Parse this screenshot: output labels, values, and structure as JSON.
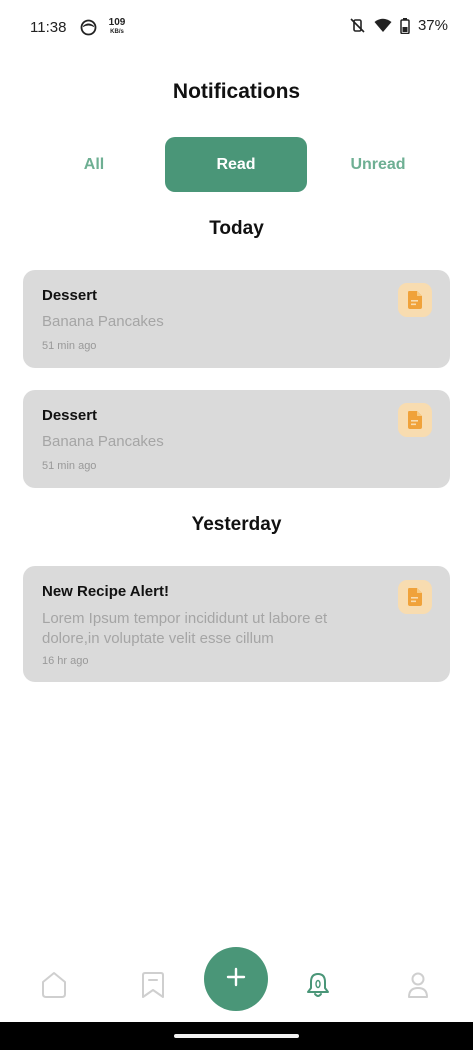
{
  "status_bar": {
    "time": "11:38",
    "speed_value": "109",
    "speed_unit": "KB/s",
    "battery": "37%"
  },
  "header": {
    "title": "Notifications"
  },
  "tabs": [
    {
      "label": "All",
      "active": false
    },
    {
      "label": "Read",
      "active": true
    },
    {
      "label": "Unread",
      "active": false
    }
  ],
  "sections": [
    {
      "title": "Today",
      "items": [
        {
          "title": "Dessert",
          "body": "Banana Pancakes",
          "time": "51 min ago",
          "icon": "document-icon"
        },
        {
          "title": "Dessert",
          "body": "Banana Pancakes",
          "time": "51 min ago",
          "icon": "document-icon"
        }
      ]
    },
    {
      "title": "Yesterday",
      "items": [
        {
          "title": "New Recipe Alert!",
          "body": "Lorem Ipsum tempor incididunt ut labore et dolore,in voluptate velit esse cillum",
          "time": "16 hr ago",
          "icon": "document-icon"
        }
      ]
    }
  ],
  "bottom_nav": {
    "items": [
      "home-icon",
      "bookmark-icon",
      "add-icon",
      "bell-icon",
      "profile-icon"
    ],
    "active": "bell-icon"
  },
  "colors": {
    "accent": "#4a9678",
    "tab_inactive": "#6eaf93",
    "card_bg": "#dadada",
    "icon_bg": "#f8dcb0",
    "icon_fg": "#f0a23a"
  }
}
